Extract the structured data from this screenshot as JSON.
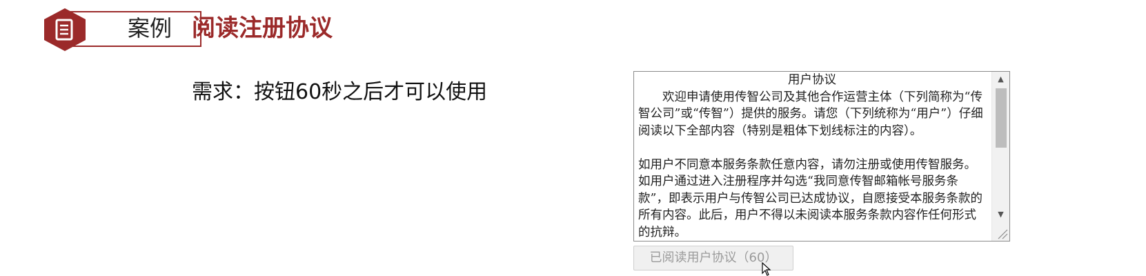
{
  "header": {
    "badge_label": "案例",
    "badge_icon": "document-icon",
    "title": "阅读注册协议"
  },
  "requirement": {
    "text": "需求：按钮60秒之后才可以使用"
  },
  "agreement": {
    "title": "用户协议",
    "paragraph1": "欢迎申请使用传智公司及其他合作运营主体（下列简称为“传智公司”或“传智”）提供的服务。请您（下列统称为“用户”）仔细阅读以下全部内容（特别是粗体下划线标注的内容）。",
    "paragraph2": "如用户不同意本服务条款任意内容，请勿注册或使用传智服务。如用户通过进入注册程序并勾选“我同意传智邮箱帐号服务条款”，即表示用户与传智公司已达成协议，自愿接受本服务条款的所有内容。此后，用户不得以未阅读本服务条款内容作任何形式的抗辩。"
  },
  "button": {
    "label": "已阅读用户协议（60）",
    "disabled": true
  },
  "colors": {
    "accent": "#9b2a2a",
    "disabled_text": "#9a9a9a",
    "disabled_bg": "#f0f0f0"
  }
}
